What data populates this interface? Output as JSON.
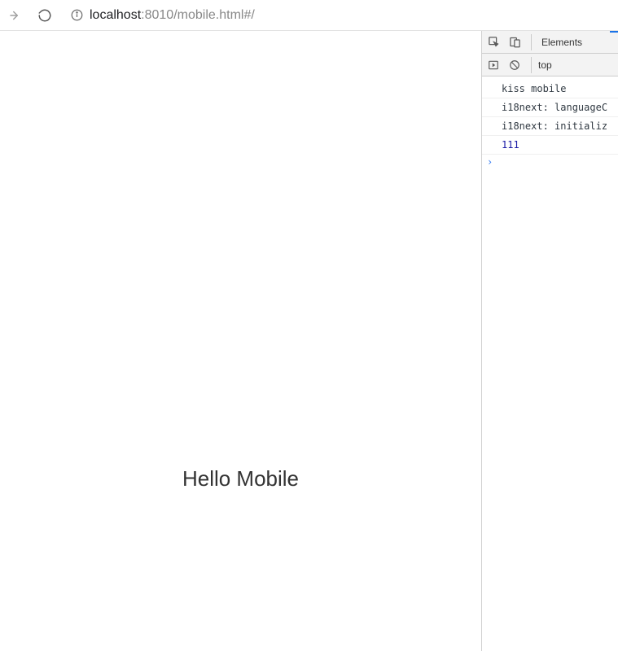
{
  "toolbar": {
    "url_primary": "localhost",
    "url_secondary": ":8010/mobile.html#/"
  },
  "page": {
    "heading": "Hello Mobile"
  },
  "devtools": {
    "tab_elements_label": "Elements",
    "context_label": "top",
    "console": {
      "lines": [
        {
          "text": "kiss mobile",
          "type": "text"
        },
        {
          "text": "i18next: languageC",
          "type": "text"
        },
        {
          "text": "i18next: initializ",
          "type": "text"
        },
        {
          "text": "111",
          "type": "number"
        }
      ]
    }
  }
}
